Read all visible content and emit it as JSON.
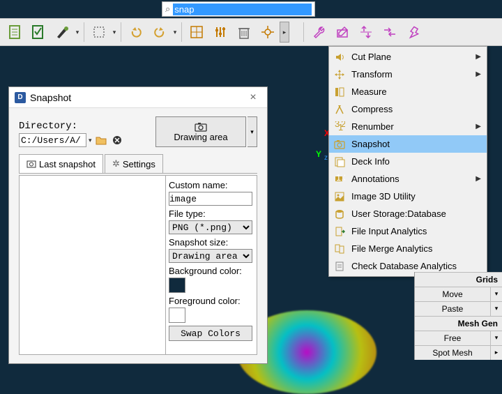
{
  "search": {
    "value": "snap"
  },
  "toolbar": {
    "icons": [
      "document-icon",
      "checklist-icon",
      "brush-icon",
      "select-icon",
      "undo-icon",
      "redo-icon",
      "split-icon",
      "sliders-icon",
      "trash-icon",
      "target-icon",
      "wrench-icon",
      "edit-layer-icon",
      "arrows-vert-icon",
      "arrows-horiz-icon",
      "bolt-icon"
    ]
  },
  "axes": {
    "x": "X",
    "y": "Y",
    "z": "z"
  },
  "dialog": {
    "title": "Snapshot",
    "dir_label": "Directory:",
    "dir_value": "C:/Users/A/",
    "drawing_area": "Drawing area",
    "tabs": {
      "last": "Last snapshot",
      "settings": "Settings"
    },
    "custom_name_label": "Custom name:",
    "custom_name": "image",
    "file_type_label": "File type:",
    "file_type": "PNG (*.png)",
    "size_label": "Snapshot size:",
    "size_value": "Drawing area",
    "bg_label": "Background color:",
    "bg_color": "#102a3d",
    "fg_label": "Foreground color:",
    "fg_color": "#ffffff",
    "swap": "Swap Colors"
  },
  "menu": {
    "items": [
      {
        "icon": "speaker",
        "label": "Cut Plane",
        "sub": true
      },
      {
        "icon": "move",
        "label": "Transform",
        "sub": true
      },
      {
        "icon": "ruler",
        "label": "Measure"
      },
      {
        "icon": "compress",
        "label": "Compress"
      },
      {
        "icon": "renumber",
        "label": "Renumber",
        "sub": true
      },
      {
        "icon": "camera",
        "label": "Snapshot",
        "hl": true
      },
      {
        "icon": "deck",
        "label": "Deck Info"
      },
      {
        "icon": "annot",
        "label": "Annotations",
        "sub": true
      },
      {
        "icon": "img3d",
        "label": "Image 3D Utility"
      },
      {
        "icon": "db",
        "label": "User Storage:Database"
      },
      {
        "icon": "filein",
        "label": "File Input Analytics"
      },
      {
        "icon": "filemerge",
        "label": "File Merge Analytics"
      },
      {
        "icon": "checkdb",
        "label": "Check Database Analytics"
      }
    ]
  },
  "side_panel": {
    "grids": "Grids",
    "move": "Move",
    "paste": "Paste",
    "meshgen": "Mesh Gen",
    "free": "Free",
    "spot": "Spot Mesh"
  }
}
